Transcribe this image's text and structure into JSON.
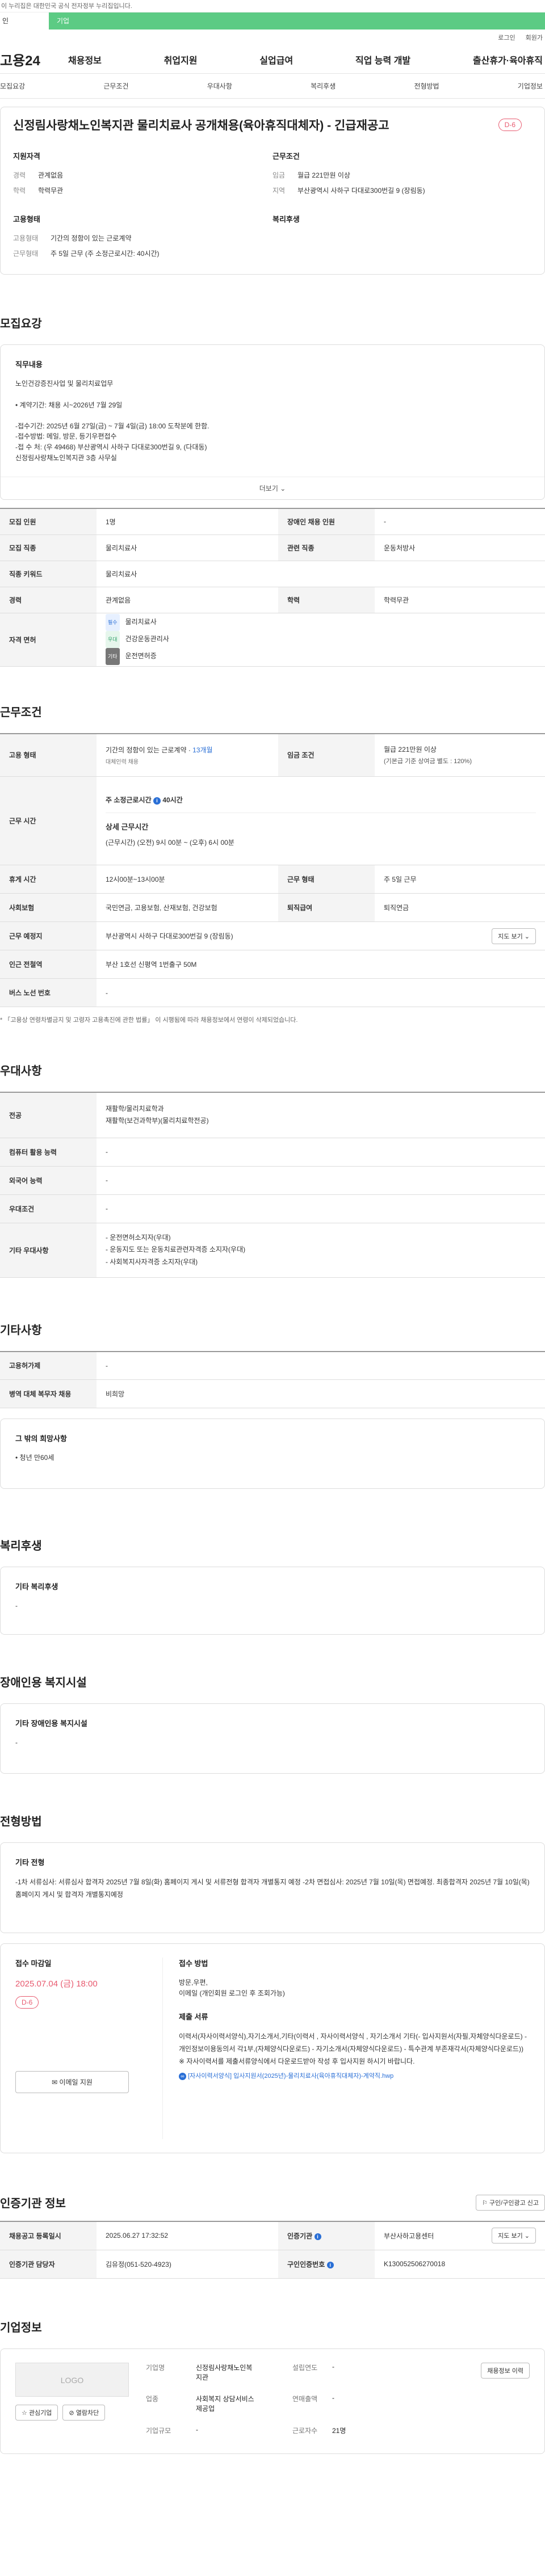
{
  "gov_notice": "이 누리집은 대한민국 공식 전자정부 누리집입니다.",
  "tabs": [
    "인",
    "기업"
  ],
  "util": [
    "로그인",
    "회원가"
  ],
  "logo": "고용24",
  "gnb": [
    "채용정보",
    "취업지원",
    "실업급여",
    "직업 능력 개발",
    "출산휴가·육아휴직"
  ],
  "snb": [
    "모집요강",
    "근무조건",
    "우대사항",
    "복리후생",
    "전형방법",
    "기업정보"
  ],
  "title": "신정림사랑채노인복지관 물리치료사 공개채용(육아휴직대체자) - 긴급재공고",
  "dday": "D-6",
  "summary": {
    "qual_title": "지원자격",
    "qual": [
      {
        "k": "경력",
        "v": "관계없음"
      },
      {
        "k": "학력",
        "v": "학력무관"
      }
    ],
    "cond_title": "근무조건",
    "cond": [
      {
        "k": "임금",
        "v": "월급 221만원 이상"
      },
      {
        "k": "지역",
        "v": "부산광역시 사하구 다대로300번길 9 (장림동)"
      }
    ],
    "emp_title": "고용형태",
    "emp": [
      {
        "k": "고용형태",
        "v": "기간의 정함이 있는 근로계약"
      },
      {
        "k": "근무형태",
        "v": "주 5일 근무 (주 소정근로시간: 40시간)"
      }
    ],
    "welfare_title": "복리후생"
  },
  "recruit": {
    "title": "모집요강",
    "job_title": "직무내용",
    "job": "노인건강증진사업 및 물리치료업무\n\n• 계약기간: 채용 시~2026년 7월 29일\n\n-접수기간: 2025년 6월 27일(금) ~ 7월 4일(금) 18:00 도착분에 한함.\n-접수방법: 메일, 방문, 등기우편접수\n-접 수 처: (우 49468) 부산광역시 사하구 다대로300번길 9, (다대동)\n            신정림사랑채노인복지관 3층 사무실",
    "more": "더보기",
    "rows": [
      [
        "모집 인원",
        "1명",
        "장애인 채용 인원",
        "-"
      ],
      [
        "모집 직종",
        "물리치료사",
        "관련 직종",
        "운동처방사"
      ],
      [
        "직종 키워드",
        "물리치료사",
        "",
        ""
      ],
      [
        "경력",
        "관계없음",
        "학력",
        "학력무관"
      ]
    ],
    "license_label": "자격 면허",
    "licenses": [
      {
        "badge": "필수",
        "name": "물리치료사"
      },
      {
        "badge": "우대",
        "name": "건강운동관리사"
      },
      {
        "badge": "기타",
        "name": "운전면허증"
      }
    ]
  },
  "work": {
    "title": "근무조건",
    "emp_label": "고용 형태",
    "emp_value": "기간의 정함이 있는 근로계약 · ",
    "emp_month": "13개월",
    "emp_sub": "대체인력 채용",
    "wage_label": "임금 조건",
    "wage_value": "월급 221만원 이상",
    "wage_sub": "(기본급 기준 상여금 별도 : 120%)",
    "hours_label": "근무 시간",
    "week_hours": "주 소정근로시간",
    "week_hours_value": "40시간",
    "detail_title": "상세 근무시간",
    "detail": "(근무시간) (오전) 9시 00분 ~ (오후) 6시 00분",
    "rows": [
      [
        "휴게 시간",
        "12시00분~13시00분",
        "근무 형태",
        "주 5일 근무"
      ],
      [
        "사회보험",
        "국민연금, 고용보험, 산재보험, 건강보험",
        "퇴직급여",
        "퇴직연금"
      ]
    ],
    "place_label": "근무 예정지",
    "place": "부산광역시 사하구 다대로300번길 9 (장림동)",
    "map_btn": "지도 보기",
    "subway_label": "인근 전철역",
    "subway": "부산 1호선 신평역 1번출구 50M",
    "bus_label": "버스 노선 번호",
    "bus": "-",
    "note": "* 「고용상 연령차별금지 및 고령자 고용촉진에 관한 법률」 이 시행됨에 따라 채용정보에서 연령이 삭제되었습니다."
  },
  "pref": {
    "title": "우대사항",
    "rows": [
      [
        "전공",
        "재활학/물리치료학과\n재활학(보건과학부)(물리치료학전공)"
      ],
      [
        "컴퓨터 활용 능력",
        "-"
      ],
      [
        "외국어 능력",
        "-"
      ],
      [
        "우대조건",
        "-"
      ],
      [
        "기타 우대사항",
        "- 운전면허소지자(우대)\n- 운동지도 또는 운동치료관련자격증 소지자(우대)\n- 사회복지사자격증 소지자(우대)"
      ]
    ]
  },
  "etc": {
    "title": "기타사항",
    "rows": [
      [
        "고용허가제",
        "-"
      ],
      [
        "병역 대체 복무자 채용",
        "비희망"
      ]
    ],
    "box_title": "그 밖의 희망사항",
    "box_item": "• 청년 만60세"
  },
  "welfare": {
    "title": "복리후생",
    "box_title": "기타 복리후생",
    "box_value": "-"
  },
  "disabled": {
    "title": "장애인용 복지시설",
    "box_title": "기타 장애인용 복지시설",
    "box_value": "-"
  },
  "process": {
    "title": "전형방법",
    "box_title": "기타 전형",
    "box_value": "-1차 서류심사: 서류심사 합격자 2025년 7월 8일(화) 홈페이지 게시 및 서류전형 합격자 개별통지 예정 -2차 면접심사: 2025년 7월 10일(목) 면접예정. 최종합격자 2025년 7월 10일(목) 홈페이지 게시 및 합격자 개별통지예정",
    "deadline_label": "접수 마감일",
    "deadline": "2025.07.04 (금) 18:00",
    "dday": "D-6",
    "email_btn": "이메일 지원",
    "method_label": "접수 방법",
    "method": "방문,우편,\n이메일 (개인회원 로그인 후 조회가능)",
    "docs_label": "제출 서류",
    "docs": "이력서(자사이력서양식),자기소개서,기타(이력서 , 자사이력서양식 , 자기소개서 기타(- 입사지원서(자필,자체양식다운로드) - 개인정보이용동의서 각1부,(자체양식다운로드) - 자기소개서(자체양식다운로드) - 특수관계 부존재각서(자체양식다운로드))\n※ 자사이력서를 제출서류양식에서 다운로드받아 작성 후 입사지원 하시기 바랍니다.",
    "file": "[자사이력서양식] 입사지원서(2025년)-물리치료사(육아휴직대체자)-계약직.hwp"
  },
  "agency": {
    "title": "인증기관 정보",
    "report_btn": "구인/구인광고 신고",
    "reg_label": "채용공고 등록일시",
    "reg": "2025.06.27 17:32:52",
    "org_label": "인증기관",
    "org": "부산사하고용센터",
    "map_btn": "지도 보기",
    "staff_label": "인증기관 담당자",
    "staff": "김유정(051-520-4923)",
    "no_label": "구인인증번호",
    "no": "K130052506270018"
  },
  "company": {
    "title": "기업정보",
    "logo": "LOGO",
    "fav_btn": "관심기업",
    "block_btn": "열람차단",
    "list_btn": "채용정보 이력",
    "name_label": "기업명",
    "name": "신정림사랑채노인복지관",
    "est_label": "설립연도",
    "est": "-",
    "emp_label": "업종",
    "emp": "사회복지 상담서비스 제공업",
    "sales_label": "연매출액",
    "sales": "-",
    "staff_label": "근로자수",
    "staff": "21명",
    "size_label": "기업규모",
    "size": "-"
  },
  "colors": {
    "accent": "#5ccb84",
    "dday": "#e85a6f",
    "link": "#2a6fd6"
  }
}
